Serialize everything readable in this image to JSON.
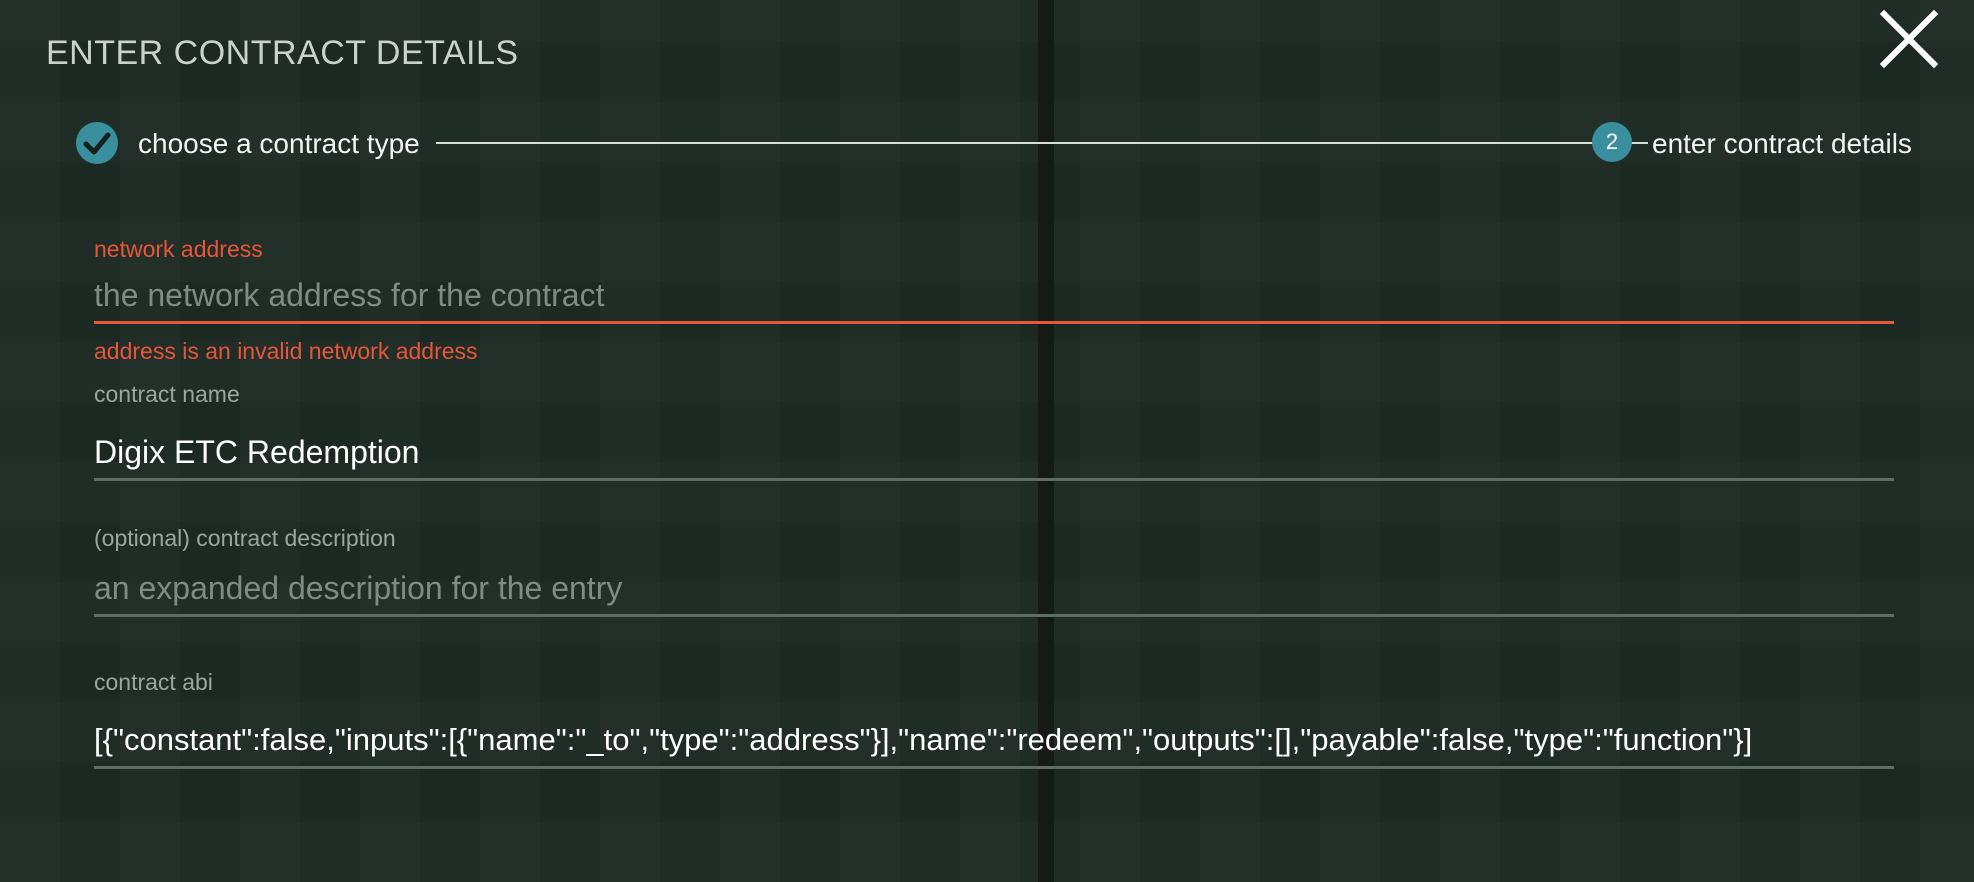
{
  "dialog": {
    "title": "ENTER CONTRACT DETAILS",
    "close_icon": "close-icon"
  },
  "stepper": {
    "step1": {
      "label": "choose a contract type",
      "status": "complete",
      "icon": "check-icon"
    },
    "step2": {
      "number": "2",
      "label": "enter contract details",
      "status": "active"
    }
  },
  "fields": {
    "address": {
      "label": "network address",
      "placeholder": "the network address for the contract",
      "value": "",
      "error": "address is an invalid network address"
    },
    "name": {
      "label": "contract name",
      "value": "Digix ETC Redemption"
    },
    "description": {
      "label": "(optional) contract description",
      "placeholder": "an expanded description for the entry",
      "value": ""
    },
    "abi": {
      "label": "contract abi",
      "value": "[{\"constant\":false,\"inputs\":[{\"name\":\"_to\",\"type\":\"address\"}],\"name\":\"redeem\",\"outputs\":[],\"payable\":false,\"type\":\"function\"}]"
    }
  },
  "colors": {
    "background": "#1e2b24",
    "accent": "#3a8f9f",
    "error": "#e8553a"
  }
}
